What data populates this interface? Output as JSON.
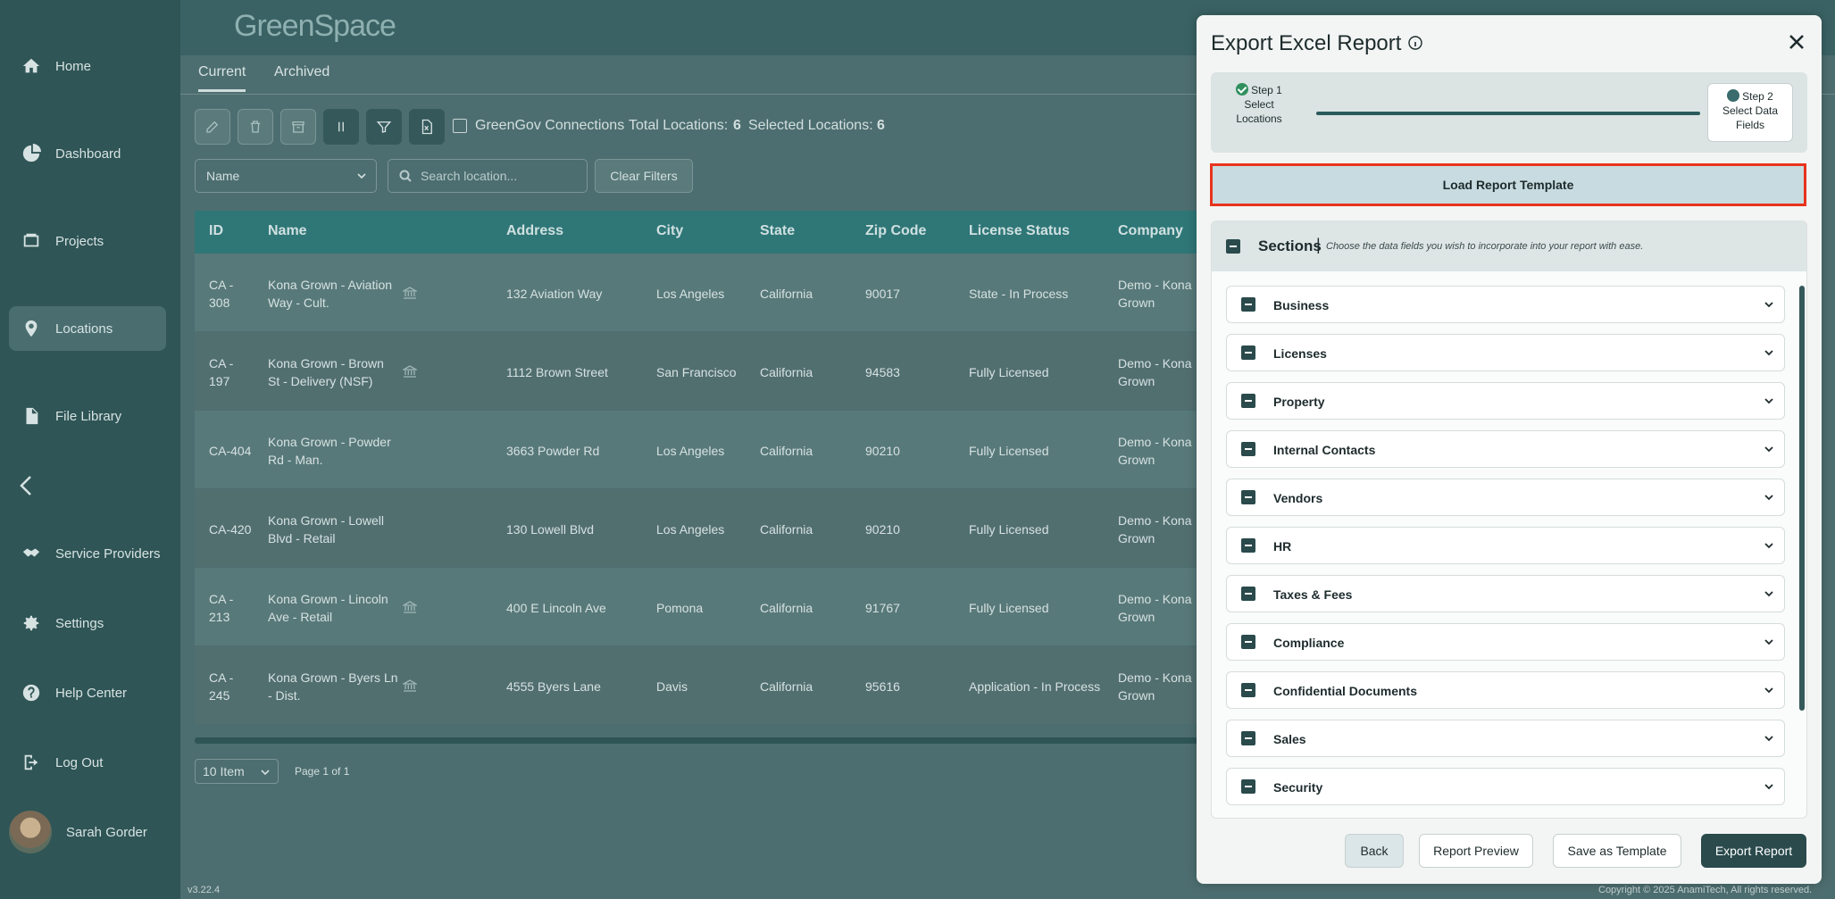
{
  "app": {
    "logo": "GreenSpace",
    "version": "v3.22.4",
    "copyright": "Copyright © 2025 AnamiTech, All rights reserved."
  },
  "sidebar": {
    "items": [
      {
        "label": "Home",
        "icon": "home-icon"
      },
      {
        "label": "Dashboard",
        "icon": "dashboard-icon"
      },
      {
        "label": "Projects",
        "icon": "projects-icon"
      },
      {
        "label": "Locations",
        "icon": "location-pin-icon",
        "active": true
      },
      {
        "label": "File Library",
        "icon": "file-icon"
      },
      {
        "label": "Service Providers",
        "icon": "handshake-icon"
      },
      {
        "label": "Settings",
        "icon": "gear-icon"
      },
      {
        "label": "Help Center",
        "icon": "help-icon"
      },
      {
        "label": "Log Out",
        "icon": "logout-icon"
      }
    ],
    "user": {
      "name": "Sarah Gorder"
    }
  },
  "tabs": [
    "Current",
    "Archived"
  ],
  "toolbar": {
    "greengov_label": "GreenGov Connections",
    "total_label": "Total Locations:",
    "total_value": "6",
    "selected_label": "Selected Locations:",
    "selected_value": "6"
  },
  "filters": {
    "sort_value": "Name",
    "search_placeholder": "Search location...",
    "clear_label": "Clear Filters"
  },
  "table": {
    "columns": [
      "ID",
      "Name",
      "Address",
      "City",
      "State",
      "Zip Code",
      "License Status",
      "Company"
    ],
    "rows": [
      {
        "id": "CA - 308",
        "name": "Kona Grown - Aviation Way - Cult.",
        "address": "132 Aviation Way",
        "city": "Los Angeles",
        "state": "California",
        "zip": "90017",
        "status": "State - In Process",
        "company": "Demo - Kona Grown"
      },
      {
        "id": "CA - 197",
        "name": "Kona Grown - Brown St - Delivery (NSF)",
        "address": "1112 Brown Street",
        "city": "San Francisco",
        "state": "California",
        "zip": "94583",
        "status": "Fully Licensed",
        "company": "Demo - Kona Grown"
      },
      {
        "id": "CA-404",
        "name": "Kona Grown - Powder Rd - Man.",
        "address": "3663 Powder Rd",
        "city": "Los Angeles",
        "state": "California",
        "zip": "90210",
        "status": "Fully Licensed",
        "company": "Demo - Kona Grown"
      },
      {
        "id": "CA-420",
        "name": "Kona Grown - Lowell Blvd - Retail",
        "address": "130 Lowell Blvd",
        "city": "Los Angeles",
        "state": "California",
        "zip": "90210",
        "status": "Fully Licensed",
        "company": "Demo - Kona Grown"
      },
      {
        "id": "CA - 213",
        "name": "Kona Grown - Lincoln Ave - Retail",
        "address": "400 E Lincoln Ave",
        "city": "Pomona",
        "state": "California",
        "zip": "91767",
        "status": "Fully Licensed",
        "company": "Demo - Kona Grown"
      },
      {
        "id": "CA - 245",
        "name": "Kona Grown - Byers Ln - Dist.",
        "address": "4555 Byers Lane",
        "city": "Davis",
        "state": "California",
        "zip": "95616",
        "status": "Application - In Process",
        "company": "Demo - Kona Grown"
      }
    ]
  },
  "pager": {
    "page_size": "10 Item",
    "page_text": "Page 1 of 1"
  },
  "modal": {
    "title": "Export Excel Report",
    "step1": {
      "title": "Step 1",
      "label": "Select Locations"
    },
    "step2": {
      "title": "Step 2",
      "label": "Select Data Fields"
    },
    "load_template": "Load Report Template",
    "sections_title": "Sections",
    "sections_desc": "Choose the data fields you wish to incorporate into your report with ease.",
    "sections": [
      "Business",
      "Licenses",
      "Property",
      "Internal Contacts",
      "Vendors",
      "HR",
      "Taxes & Fees",
      "Compliance",
      "Confidential Documents",
      "Sales",
      "Security"
    ],
    "buttons": {
      "back": "Back",
      "preview": "Report Preview",
      "save_template": "Save as Template",
      "export": "Export Report"
    }
  }
}
